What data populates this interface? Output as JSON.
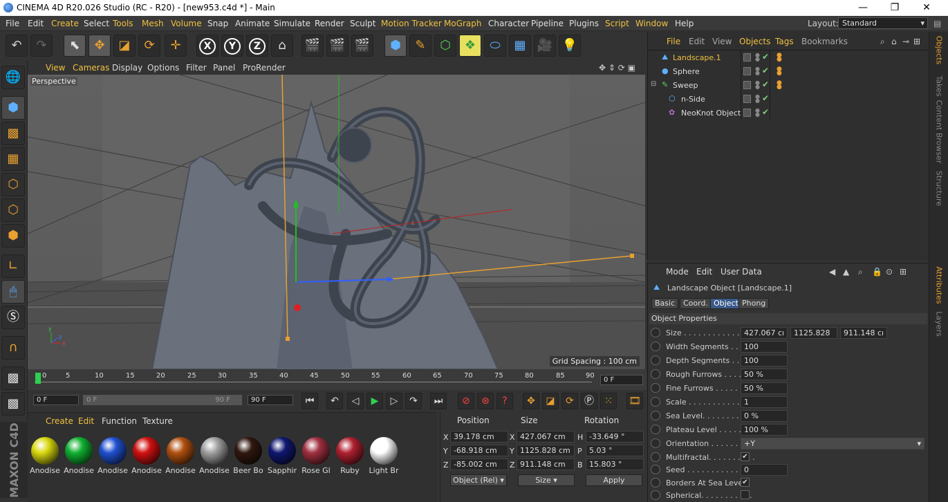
{
  "titlebar": {
    "title": "CINEMA 4D R20.026 Studio (RC - R20) - [new953.c4d *] - Main",
    "minimize": "—",
    "restore": "❐",
    "close": "✕"
  },
  "menubar": {
    "items": [
      "File",
      "Edit",
      "Create",
      "Select",
      "Tools",
      "Mesh",
      "Volume",
      "Snap",
      "Animate",
      "Simulate",
      "Render",
      "Sculpt",
      "Motion Tracker",
      "MoGraph",
      "Character",
      "Pipeline",
      "Plugins",
      "Script",
      "Window",
      "Help"
    ],
    "layout_label": "Layout:",
    "layout_value": "Standard"
  },
  "toolbar": {
    "x": "X",
    "y": "Y",
    "z": "Z"
  },
  "viewport": {
    "menu": [
      "View",
      "Cameras",
      "Display",
      "Options",
      "Filter",
      "Panel",
      "ProRender"
    ],
    "label": "Perspective",
    "grid_spacing": "Grid Spacing : 100 cm"
  },
  "timeline": {
    "ticks": [
      "0",
      "5",
      "10",
      "15",
      "20",
      "25",
      "30",
      "35",
      "40",
      "45",
      "50",
      "55",
      "60",
      "65",
      "70",
      "75",
      "80",
      "85",
      "90"
    ],
    "current_frame": "0 F",
    "start_frame": "0 F",
    "range_start": "0 F",
    "range_end": "90 F",
    "end_frame": "90 F"
  },
  "materials": {
    "menu": [
      "Create",
      "Edit",
      "Function",
      "Texture"
    ],
    "items": [
      {
        "label": "Anodise",
        "color": "#d8d810"
      },
      {
        "label": "Anodise",
        "color": "#10b030"
      },
      {
        "label": "Anodise",
        "color": "#2050d0"
      },
      {
        "label": "Anodise",
        "color": "#d01010"
      },
      {
        "label": "Anodise",
        "color": "#b05010"
      },
      {
        "label": "Anodise",
        "color": "#a0a0a0"
      },
      {
        "label": "Beer Bo",
        "color": "#301810"
      },
      {
        "label": "Sapphir",
        "color": "#101870"
      },
      {
        "label": "Rose Gl",
        "color": "#a03040"
      },
      {
        "label": "Ruby",
        "color": "#b02030"
      },
      {
        "label": "Light Br",
        "color": "#ffffff"
      }
    ]
  },
  "coords": {
    "headers": [
      "Position",
      "Size",
      "Rotation"
    ],
    "rows": [
      {
        "axis": "X",
        "pos": "39.178 cm",
        "sax": "X",
        "size": "427.067 cm",
        "rax": "H",
        "rot": "-33.649 °"
      },
      {
        "axis": "Y",
        "pos": "-68.918 cm",
        "sax": "Y",
        "size": "1125.828 cm",
        "rax": "P",
        "rot": "5.03 °"
      },
      {
        "axis": "Z",
        "pos": "-85.002 cm",
        "sax": "Z",
        "size": "911.148 cm",
        "rax": "B",
        "rot": "15.803 °"
      }
    ],
    "mode": "Object (Rel)",
    "size_mode": "Size",
    "apply": "Apply"
  },
  "object_manager": {
    "menu": [
      "File",
      "Edit",
      "View",
      "Objects",
      "Tags",
      "Bookmarks"
    ],
    "objects": [
      {
        "name": "Landscape.1",
        "active": true
      },
      {
        "name": "Sphere",
        "active": false
      },
      {
        "name": "Sweep",
        "active": false
      },
      {
        "name": "n-Side",
        "active": false
      },
      {
        "name": "NeoKnot Object",
        "active": false
      }
    ]
  },
  "right_tabs": [
    "Objects",
    "Takes",
    "Content Browser",
    "Structure",
    "Attributes",
    "Layers"
  ],
  "attributes": {
    "menu": [
      "Mode",
      "Edit",
      "User Data"
    ],
    "object_title": "Landscape Object [Landscape.1]",
    "tabs": [
      "Basic",
      "Coord.",
      "Object",
      "Phong"
    ],
    "section": "Object Properties",
    "size": [
      "427.067 cı",
      "1125.828",
      "911.148 cı"
    ],
    "props": [
      {
        "label": "Size . . . . . . . . . . . . . . . .",
        "value": ""
      },
      {
        "label": "Width Segments . . . . .",
        "value": "100"
      },
      {
        "label": "Depth Segments . . . . .",
        "value": "100"
      },
      {
        "label": "Rough Furrows . . . . . .",
        "value": "50 %"
      },
      {
        "label": "Fine Furrows . . . . . . . .",
        "value": "50 %"
      },
      {
        "label": "Scale . . . . . . . . . . . . . . .",
        "value": "1"
      },
      {
        "label": "Sea Level. . . . . . . . . . .",
        "value": "0 %"
      },
      {
        "label": "Plateau Level . . . . . . .",
        "value": "100 %"
      },
      {
        "label": "Orientation . . . . . . . . .",
        "value": "+Y"
      },
      {
        "label": "Multifractal. . . . . . . . . .",
        "value": "✔"
      },
      {
        "label": "Seed . . . . . . . . . . . . . . .",
        "value": "0"
      },
      {
        "label": "Borders At Sea Level",
        "value": "✔"
      },
      {
        "label": "Spherical. . . . . . . . . . .",
        "value": ""
      }
    ]
  }
}
